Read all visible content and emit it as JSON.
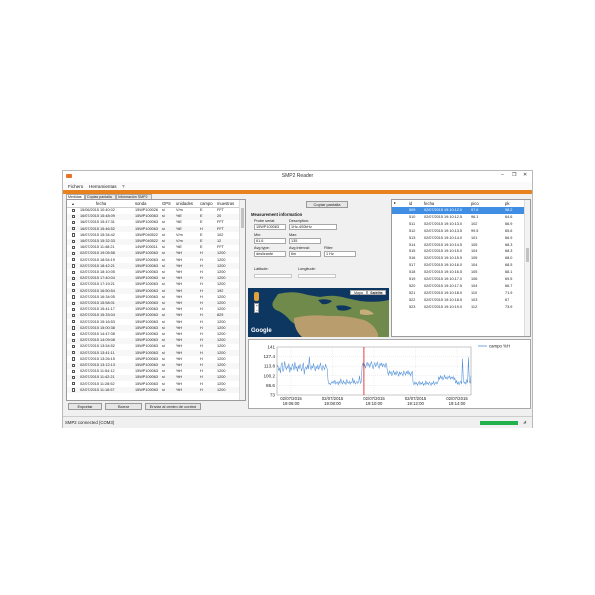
{
  "window": {
    "title": "SMP2 Reader",
    "minimize": "–",
    "restore": "❐",
    "close": "✕"
  },
  "menu": {
    "file": "Fichero",
    "tools": "Herramientas",
    "help": "?"
  },
  "tabs": [
    "Medidas",
    "Copias pantalla",
    "Información SMP2"
  ],
  "list": {
    "headers": [
      "fecha",
      "sonda",
      "GPS",
      "unidades",
      "campo",
      "muestras"
    ],
    "rows": [
      [
        "15/06/2015 10:40:02",
        "15WP100026",
        "si",
        "V/m",
        "E",
        "FFT"
      ],
      [
        "16/07/2015 15:48:09",
        "15WP100063",
        "si",
        "%E",
        "E",
        "20"
      ],
      [
        "16/07/2015 15:47:31",
        "15WP100063",
        "si",
        "%E",
        "E",
        "FFT"
      ],
      [
        "16/07/2015 15:46:52",
        "15WP100063",
        "si",
        "%E",
        "H",
        "FFT"
      ],
      [
        "16/07/2015 15:34:42",
        "15WP040522",
        "si",
        "V/m",
        "E",
        "102"
      ],
      [
        "16/07/2015 15:32:33",
        "15WP040522",
        "si",
        "V/m",
        "E",
        "12"
      ],
      [
        "16/07/2015 11:48:21",
        "14WP100011",
        "si",
        "%E",
        "E",
        "FFT"
      ],
      [
        "02/07/2015 19:05:58",
        "15WP100063",
        "si",
        "%H",
        "H",
        "1200"
      ],
      [
        "02/07/2015 18:54:19",
        "15WP100063",
        "si",
        "%H",
        "H",
        "1200"
      ],
      [
        "02/07/2015 18:42:21",
        "15WP100063",
        "si",
        "%H",
        "H",
        "1200"
      ],
      [
        "02/07/2015 18:10:05",
        "15WP100063",
        "si",
        "%H",
        "H",
        "1200"
      ],
      [
        "02/07/2015 17:40:04",
        "15WP100063",
        "si",
        "%H",
        "H",
        "1200"
      ],
      [
        "02/07/2015 17:19:21",
        "15WP100063",
        "si",
        "%H",
        "H",
        "1200"
      ],
      [
        "02/07/2015 16:50:54",
        "15WP100063",
        "si",
        "%H",
        "H",
        "192"
      ],
      [
        "02/07/2015 16:34:05",
        "15WP100063",
        "si",
        "%H",
        "H",
        "1200"
      ],
      [
        "02/07/2015 15:58:01",
        "15WP100063",
        "si",
        "%H",
        "H",
        "1200"
      ],
      [
        "02/07/2015 15:41:17",
        "15WP100063",
        "si",
        "%H",
        "H",
        "1200"
      ],
      [
        "02/07/2015 15:33:04",
        "15WP100063",
        "si",
        "%H",
        "H",
        "829"
      ],
      [
        "02/07/2015 15:16:53",
        "15WP100063",
        "si",
        "%H",
        "H",
        "1200"
      ],
      [
        "02/07/2015 15:00:38",
        "15WP100063",
        "si",
        "%H",
        "H",
        "1200"
      ],
      [
        "02/07/2015 14:47:08",
        "15WP100063",
        "si",
        "%H",
        "H",
        "1200"
      ],
      [
        "02/07/2015 14:09:08",
        "15WP100063",
        "si",
        "%H",
        "H",
        "1200"
      ],
      [
        "02/07/2015 13:54:52",
        "15WP100063",
        "si",
        "%H",
        "H",
        "1200"
      ],
      [
        "02/07/2015 13:41:11",
        "15WP100063",
        "si",
        "%H",
        "H",
        "1200"
      ],
      [
        "02/07/2015 13:26:15",
        "15WP100063",
        "si",
        "%H",
        "H",
        "1200"
      ],
      [
        "02/07/2015 13:12:13",
        "15WP100063",
        "si",
        "%H",
        "H",
        "1200"
      ],
      [
        "02/07/2015 11:54:12",
        "15WP100063",
        "si",
        "%H",
        "H",
        "1200"
      ],
      [
        "02/07/2015 11:42:21",
        "15WP100063",
        "si",
        "%H",
        "H",
        "1200"
      ],
      [
        "02/07/2015 11:28:52",
        "15WP100063",
        "si",
        "%H",
        "H",
        "1200"
      ],
      [
        "02/07/2015 11:16:57",
        "15WP100063",
        "si",
        "%H",
        "H",
        "1200"
      ]
    ]
  },
  "buttons": {
    "export": "Exportar",
    "delete": "Borrar",
    "send": "Enviar al centro de control",
    "screenshot": "Copiar pantalla"
  },
  "measurement": {
    "heading": "Measurement information",
    "probe_serial_label": "Probe serial:",
    "probe_serial": "15WP100063",
    "description_label": "Description:",
    "description": "1Hz-400kHz",
    "min_label": "Min:",
    "min": "61.6",
    "max_label": "Max:",
    "max": "135",
    "avg_type_label": "Avg type:",
    "avg_type": "deslizante",
    "avg_interval_label": "Avg interval:",
    "avg_interval": "6m",
    "filter_label": "Filter:",
    "filter": "1 Hz",
    "latitude_label": "Latitude:",
    "longitude_label": "Longitude:"
  },
  "map": {
    "map_btn": "Mapa",
    "satellite_btn": "Satélite",
    "logo": "Google",
    "zoom_in": "+",
    "zoom_out": "−"
  },
  "table": {
    "headers": [
      "id",
      "fecha",
      "pico",
      "pk"
    ],
    "rows": [
      [
        "509",
        "02/07/2015 19:10:12.0",
        "97.6",
        "98.2"
      ],
      [
        "510",
        "02/07/2015 19:10:12.5",
        "96.1",
        "64.6"
      ],
      [
        "511",
        "02/07/2015 19:10:13.0",
        "102",
        "66.9"
      ],
      [
        "512",
        "02/07/2015 19:10:13.5",
        "99.5",
        "65.6"
      ],
      [
        "513",
        "02/07/2015 19:10:14.0",
        "101",
        "66.9"
      ],
      [
        "514",
        "02/07/2015 19:10:14.5",
        "105",
        "68.3"
      ],
      [
        "515",
        "02/07/2015 19:10:15.0",
        "104",
        "68.3"
      ],
      [
        "516",
        "02/07/2015 19:10:15.5",
        "105",
        "68.0"
      ],
      [
        "517",
        "02/07/2015 19:10:16.0",
        "104",
        "68.5"
      ],
      [
        "518",
        "02/07/2015 19:10:16.5",
        "105",
        "68.1"
      ],
      [
        "519",
        "02/07/2015 19:10:17.0",
        "106",
        "69.5"
      ],
      [
        "520",
        "02/07/2015 19:10:17.5",
        "104",
        "66.7"
      ],
      [
        "521",
        "02/07/2015 19:10:18.0",
        "110",
        "71.9"
      ],
      [
        "522",
        "02/07/2015 19:10:18.5",
        "103",
        "67"
      ],
      [
        "523",
        "02/07/2015 19:10:19.0",
        "112",
        "73.9"
      ]
    ]
  },
  "chart_data": {
    "type": "line",
    "ylim": [
      71,
      141
    ],
    "yticks": [
      "141",
      "127.4",
      "113.8",
      "100.2",
      "86.6",
      "73"
    ],
    "xticks": [
      [
        "02/07/2015",
        "19:06:00"
      ],
      [
        "02/07/2015",
        "19:08:00"
      ],
      [
        "02/07/2015",
        "19:10:00"
      ],
      [
        "02/07/2015",
        "19:12:00"
      ],
      [
        "02/07/2015",
        "19:14:00"
      ]
    ],
    "series": [
      {
        "name": "campo %H",
        "color": "#4f8fd8",
        "values": [
          112,
          114,
          107,
          110,
          103,
          116,
          118,
          105,
          109,
          120,
          112,
          108,
          113,
          110,
          117,
          104,
          111,
          108,
          116,
          113,
          107,
          119,
          110,
          112,
          105,
          114,
          109,
          116,
          111,
          106,
          113,
          118,
          101,
          110,
          112,
          108,
          115,
          109,
          127,
          112,
          108,
          114,
          110,
          117,
          111,
          106,
          113,
          109,
          115,
          108,
          112,
          118,
          110,
          107,
          114,
          111,
          108,
          116,
          112,
          109,
          92,
          87,
          88,
          86,
          90,
          89,
          91,
          88,
          93,
          87,
          89,
          90,
          86,
          91,
          88,
          95,
          89,
          87,
          92,
          88,
          90,
          86,
          94,
          89,
          88,
          91,
          87,
          90,
          89,
          96,
          88,
          92,
          87,
          89,
          91,
          88,
          90,
          99,
          88,
          90,
          113,
          118,
          112,
          116,
          110,
          115,
          119,
          113,
          117,
          111,
          116,
          120,
          114,
          109,
          115,
          118,
          112,
          116,
          119,
          113,
          110,
          117,
          114,
          118,
          112,
          116,
          115,
          111,
          118,
          113,
          104,
          100,
          106,
          102,
          105,
          99,
          103,
          107,
          101,
          104,
          100,
          106,
          103,
          98,
          105,
          101,
          104,
          102,
          99,
          106,
          103,
          100,
          105,
          102,
          107,
          101,
          104,
          99,
          103,
          106,
          88,
          86,
          90,
          87,
          89,
          85,
          88,
          91,
          86,
          89,
          87,
          90,
          85,
          88,
          86,
          92,
          87,
          89,
          86,
          90,
          88,
          85,
          89,
          87,
          91,
          86,
          88,
          90,
          87,
          89,
          97,
          94,
          99,
          95,
          98,
          93,
          96,
          100,
          95,
          97,
          94,
          98,
          96,
          99,
          94,
          97,
          95,
          98,
          93,
          96,
          88,
          92,
          87,
          90,
          86,
          89,
          91,
          87,
          124,
          92,
          88,
          90,
          87,
          93,
          89,
          126,
          91,
          88,
          99
        ]
      }
    ],
    "cursor_fraction": 0.448,
    "legend": "top-right"
  },
  "status": {
    "text": "SMP2 connected (COM3)",
    "progress": 1.0
  }
}
